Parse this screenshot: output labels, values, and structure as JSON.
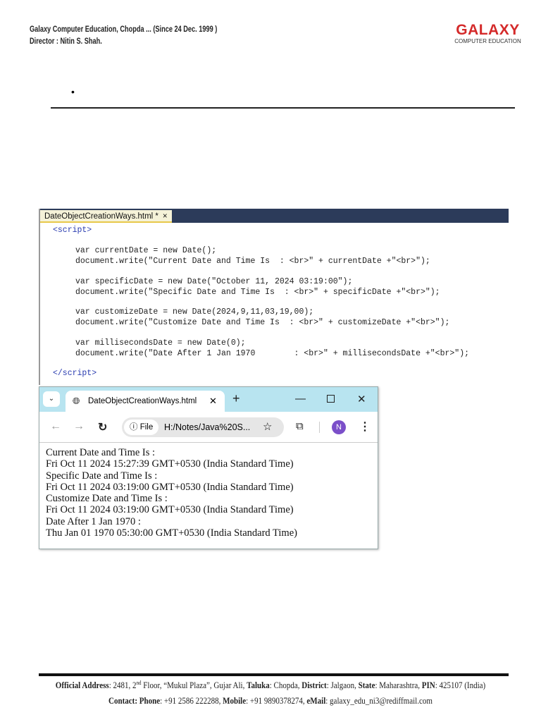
{
  "header": {
    "line1": "Galaxy Computer Education, Chopda ... (Since 24 Dec. 1999 )",
    "line2": "Director : Nitin S. Shah.",
    "logo_main": "GALAXY",
    "logo_sub": "COMPUTER EDUCATION"
  },
  "bullet": "•",
  "editor": {
    "tab_label": "DateObjectCreationWays.html *",
    "tab_close": "×",
    "lines": [
      "<script>",
      "var currentDate = new Date();",
      "document.write(\"Current Date and Time Is  : <br>\" + currentDate +\"<br>\");",
      "var specificDate = new Date(\"October 11, 2024 03:19:00\");",
      "document.write(\"Specific Date and Time Is  : <br>\" + specificDate +\"<br>\");",
      "var customizeDate = new Date(2024,9,11,03,19,00);",
      "document.write(\"Customize Date and Time Is  : <br>\" + customizeDate +\"<br>\");",
      "var millisecondsDate = new Date(0);",
      "document.write(\"Date After 1 Jan 1970        : <br>\" + millisecondsDate +\"<br>\");",
      "</script>"
    ]
  },
  "browser": {
    "tab_title": "DateObjectCreationWays.html",
    "file_label": "File",
    "url": "H:/Notes/Java%20S...",
    "avatar": "N",
    "output": [
      "Current Date and Time Is :",
      "Fri Oct 11 2024 15:27:39 GMT+0530 (India Standard Time)",
      "Specific Date and Time Is :",
      "Fri Oct 11 2024 03:19:00 GMT+0530 (India Standard Time)",
      "Customize Date and Time Is :",
      "Fri Oct 11 2024 03:19:00 GMT+0530 (India Standard Time)",
      "Date After 1 Jan 1970 :",
      "Thu Jan 01 1970 05:30:00 GMT+0530 (India Standard Time)"
    ]
  },
  "footer": {
    "addr_label": "Official Address",
    "addr1": ": 2481, 2",
    "sup": "nd",
    "addr2": " Floor, “Mukul Plaza”, Gujar Ali, ",
    "taluka_label": "Taluka",
    "taluka": ": Chopda, ",
    "district_label": "District",
    "district": ": Jalgaon, ",
    "state_label": "State",
    "state": ": Maharashtra, ",
    "pin_label": "PIN",
    "pin": ": 425107 (India)",
    "contact_label": "Contact: Phone",
    "phone": ": +91 2586 222288, ",
    "mobile_label": "Mobile",
    "mobile": ": +91 9890378274, ",
    "email_label": "eMail",
    "email": ": galaxy_edu_ni3@rediffmail.com"
  }
}
